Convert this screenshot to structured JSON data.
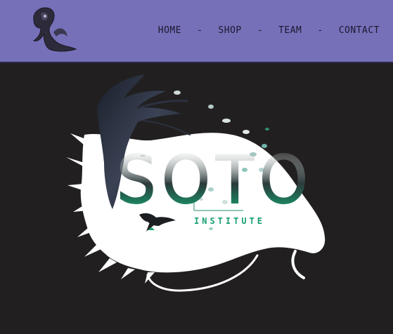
{
  "header": {
    "background": "#7670b8",
    "logo_icon": "wizard-logo-icon"
  },
  "nav": {
    "items": [
      {
        "label": "HOME"
      },
      {
        "label": "SHOP"
      },
      {
        "label": "TEAM"
      },
      {
        "label": "CONTACT"
      }
    ],
    "separator": "-"
  },
  "hero": {
    "brand_title": "SOTO",
    "brand_subtitle": "INSTITUTE",
    "accent": "#1aa36b",
    "background": "#211f20"
  }
}
